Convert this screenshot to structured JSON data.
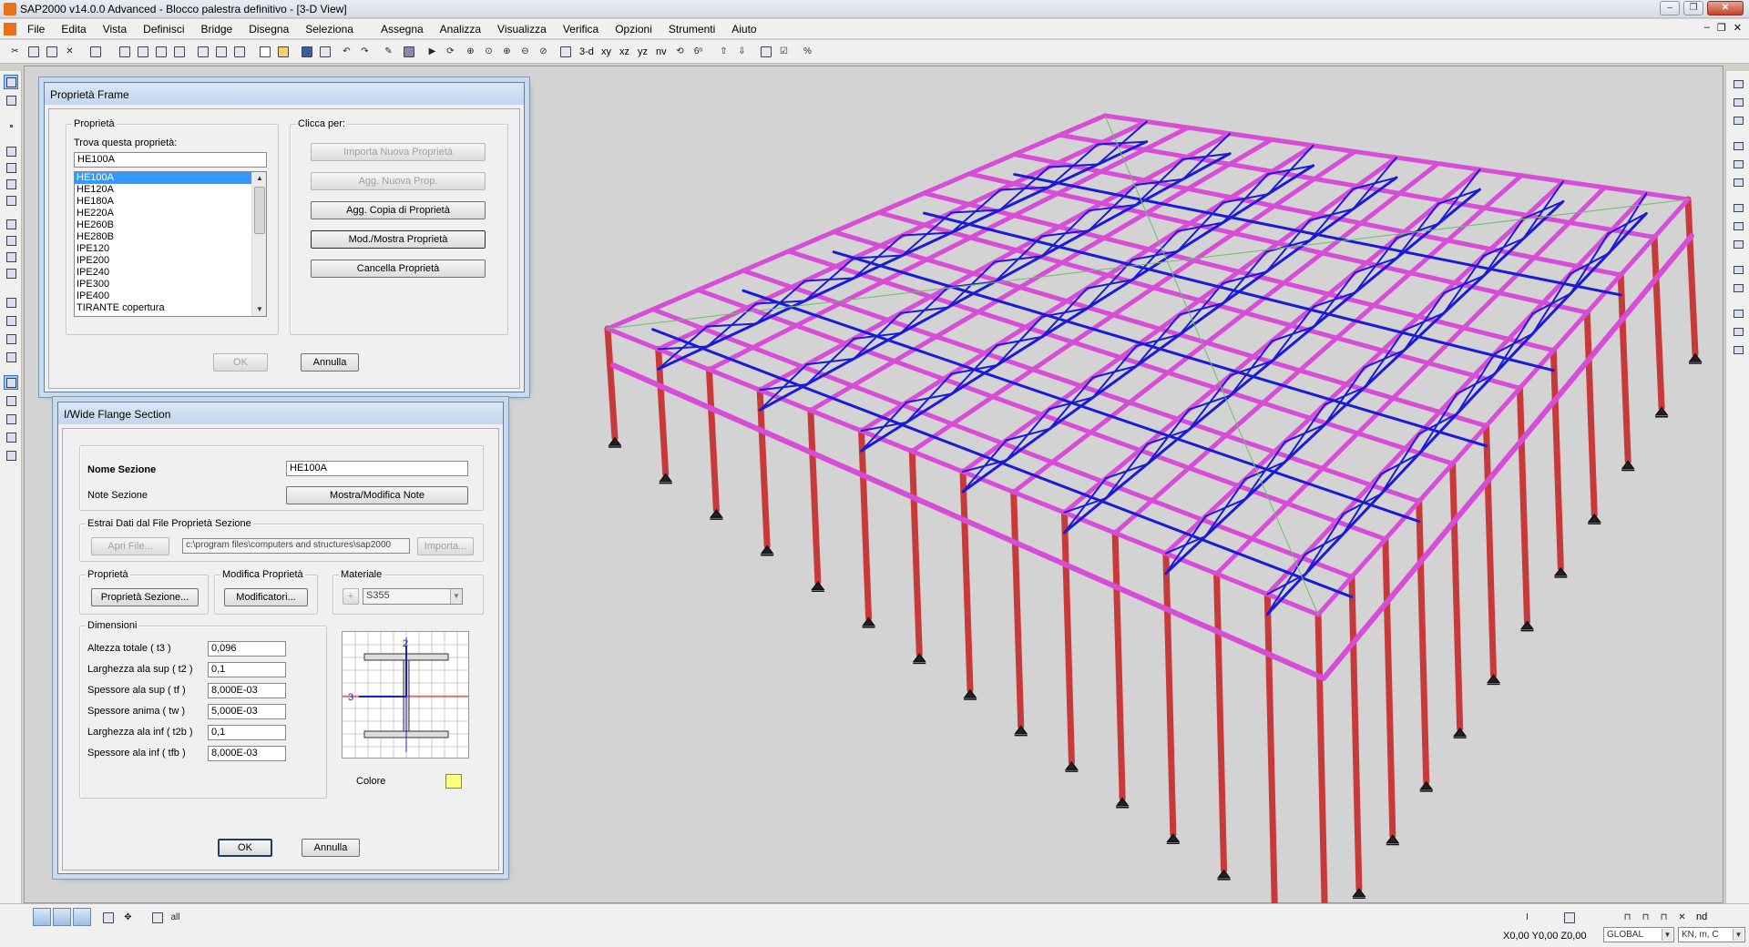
{
  "window": {
    "title": "SAP2000 v14.0.0 Advanced  -  Blocco palestra definitivo - [3-D View]"
  },
  "menu": [
    "File",
    "Edita",
    "Vista",
    "Definisci",
    "Bridge",
    "Disegna",
    "Seleziona",
    "Assegna",
    "Analizza",
    "Visualizza",
    "Verifica",
    "Opzioni",
    "Strumenti",
    "Aiuto"
  ],
  "toolbar": {
    "view_labels": [
      "3-d",
      "xy",
      "xz",
      "yz",
      "nv"
    ]
  },
  "frame_props": {
    "title": "Proprietà Frame",
    "group_props": "Proprietà",
    "find_label": "Trova questa proprietà:",
    "find_value": "HE100A",
    "items": [
      "HE100A",
      "HE120A",
      "HE180A",
      "HE220A",
      "HE260B",
      "HE280B",
      "IPE120",
      "IPE200",
      "IPE240",
      "IPE300",
      "IPE400",
      "TIRANTE copertura"
    ],
    "selected_index": 0,
    "group_click": "Clicca per:",
    "btn_import": "Importa Nuova Proprietà",
    "btn_add": "Agg. Nuova Prop.",
    "btn_copy": "Agg. Copia di Proprietà",
    "btn_modify": "Mod./Mostra Proprietà",
    "btn_delete": "Cancella Proprietà",
    "btn_ok": "OK",
    "btn_cancel": "Annulla"
  },
  "section": {
    "title": "I/Wide Flange Section",
    "name_label": "Nome Sezione",
    "name_value": "HE100A",
    "notes_label": "Note Sezione",
    "notes_btn": "Mostra/Modifica Note",
    "extract_label": "Estrai Dati dal File Proprietà Sezione",
    "open_file_btn": "Apri File...",
    "file_path": "c:\\program files\\computers and structures\\sap2000",
    "import_btn": "Importa...",
    "props_group": "Proprietà",
    "props_btn": "Proprietà Sezione...",
    "modify_group": "Modifica Proprietà",
    "modify_btn": "Modificatori...",
    "material_group": "Materiale",
    "material_value": "S355",
    "dims_group": "Dimensioni",
    "dims": [
      {
        "label": "Altezza totale ( t3 )",
        "value": "0,096"
      },
      {
        "label": "Larghezza ala sup ( t2 )",
        "value": "0,1"
      },
      {
        "label": "Spessore ala sup ( tf )",
        "value": "8,000E-03"
      },
      {
        "label": "Spessore anima ( tw )",
        "value": "5,000E-03"
      },
      {
        "label": "Larghezza ala inf ( t2b )",
        "value": "0,1"
      },
      {
        "label": "Spessore ala inf ( tfb )",
        "value": "8,000E-03"
      }
    ],
    "axis2": "2",
    "axis3": "3",
    "color_label": "Colore",
    "color": "#ffff80",
    "btn_ok": "OK",
    "btn_cancel": "Annulla"
  },
  "status": {
    "coords": "X0,00  Y0,00  Z0,00",
    "system": "GLOBAL",
    "units": "KN, m, C",
    "nd_label": "nd"
  },
  "colors": {
    "beam_magenta": "#d84dd8",
    "truss_blue": "#1a1ad8",
    "column_red": "#c83a3a",
    "background_view": "#d3d3d3"
  }
}
